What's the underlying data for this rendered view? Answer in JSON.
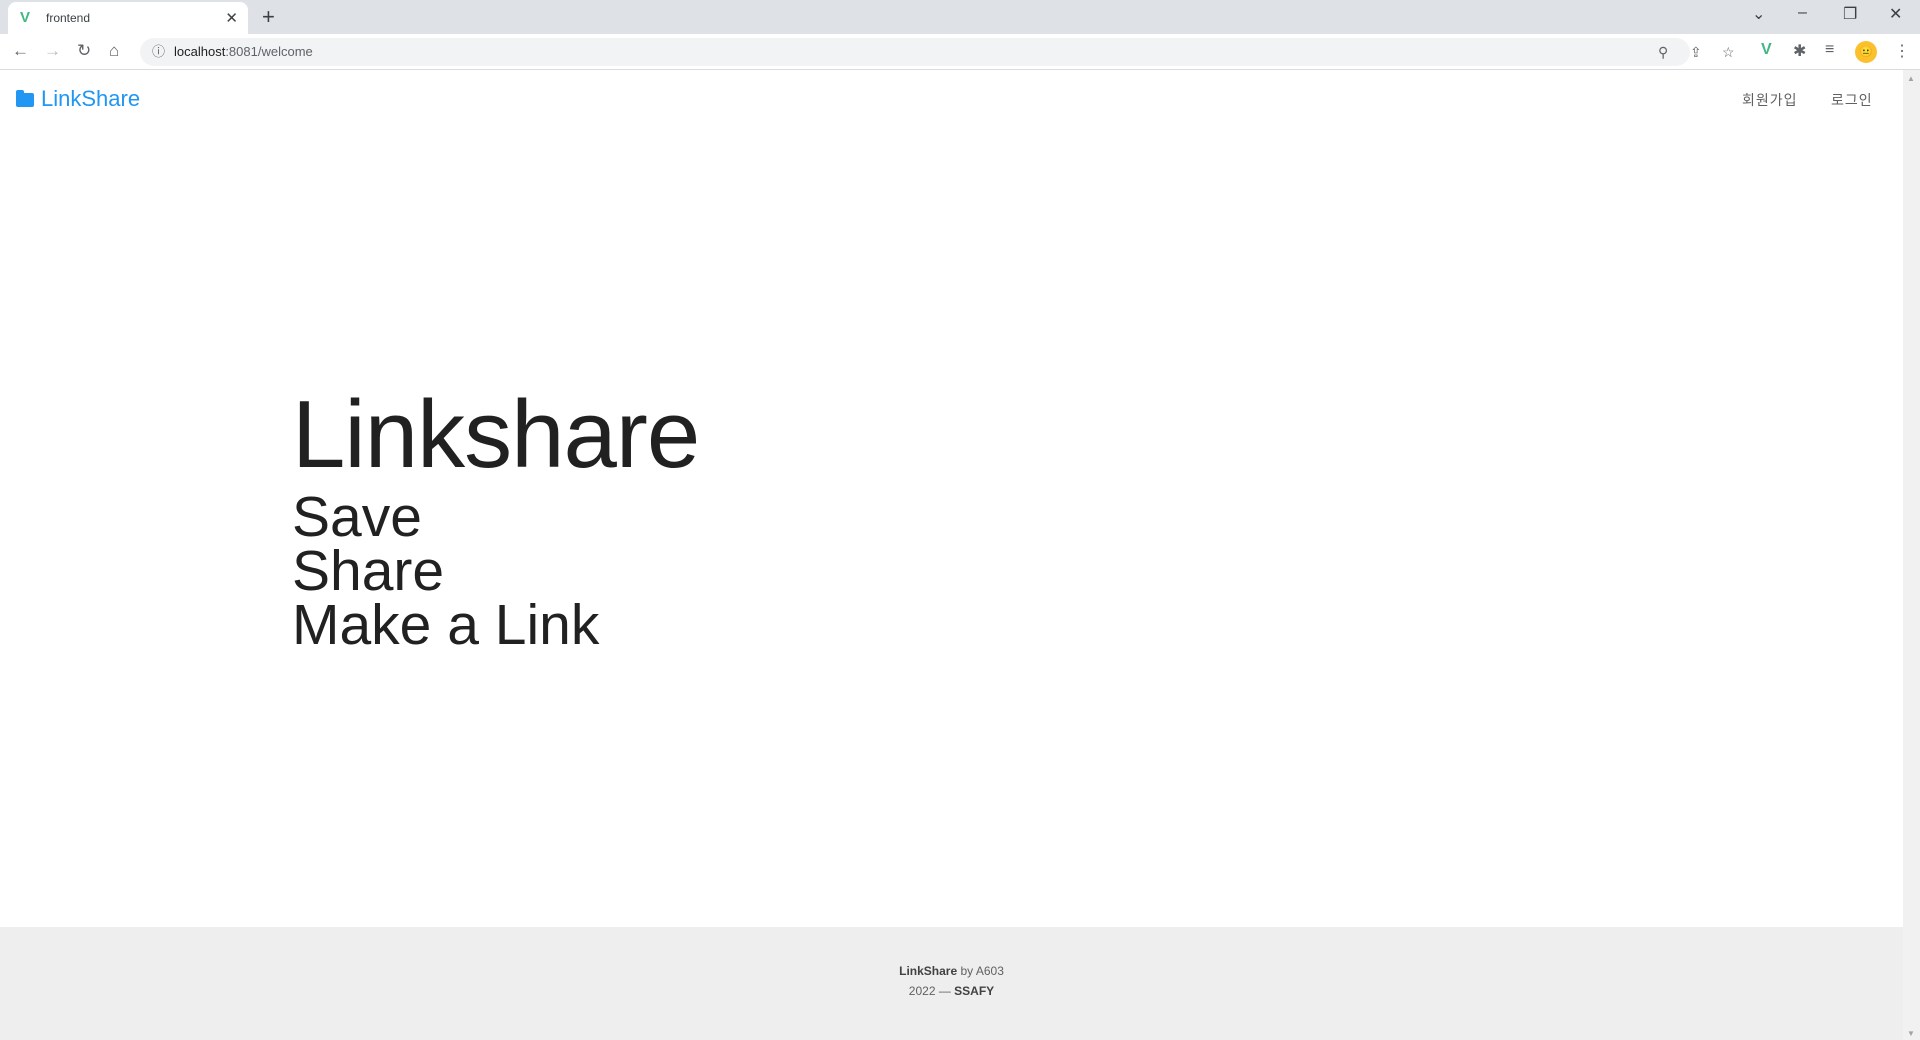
{
  "browser": {
    "tab_title": "frontend",
    "url_host": "localhost",
    "url_path": ":8081/welcome"
  },
  "header": {
    "brand": "LinkShare",
    "nav": [
      {
        "label": "회원가입"
      },
      {
        "label": "로그인"
      }
    ]
  },
  "hero": {
    "title": "Linkshare",
    "lines": [
      "Save",
      "Share",
      "Make a Link"
    ]
  },
  "footer": {
    "brand": "LinkShare",
    "by": " by A603",
    "year": "2022 — ",
    "org": "SSAFY"
  },
  "colors": {
    "brand": "#2196f3",
    "footer_bg": "#eeeeee"
  }
}
